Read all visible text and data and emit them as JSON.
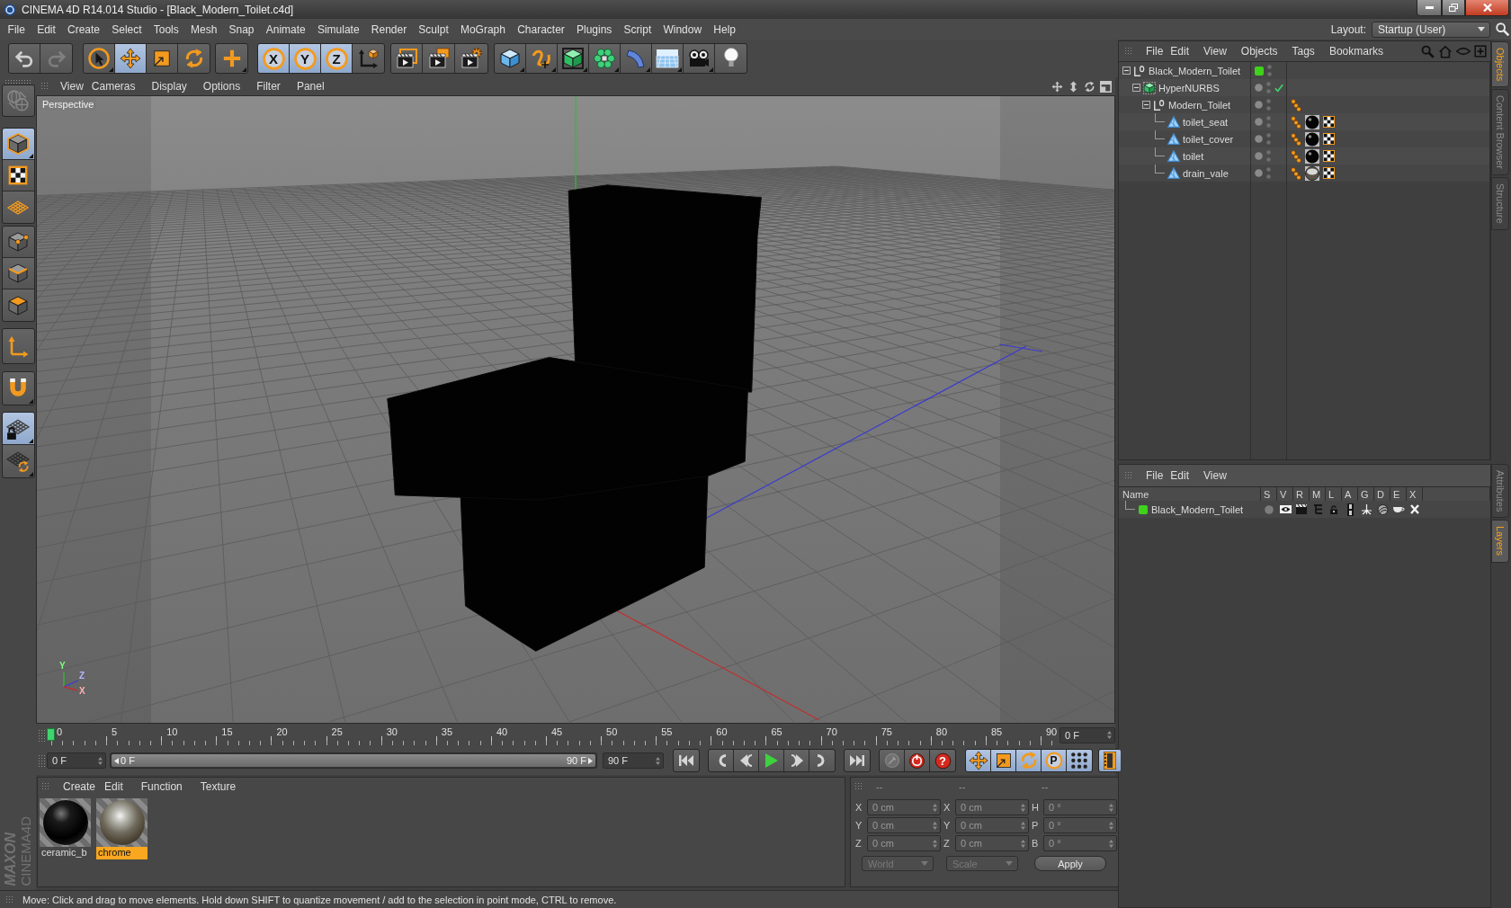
{
  "window": {
    "title": "CINEMA 4D R14.014 Studio - [Black_Modern_Toilet.c4d]"
  },
  "menu": [
    "File",
    "Edit",
    "Create",
    "Select",
    "Tools",
    "Mesh",
    "Snap",
    "Animate",
    "Simulate",
    "Render",
    "Sculpt",
    "MoGraph",
    "Character",
    "Plugins",
    "Script",
    "Window",
    "Help"
  ],
  "layout": {
    "label": "Layout:",
    "value": "Startup (User)"
  },
  "toolbar": {
    "history": [
      {
        "disabled": false
      },
      {
        "disabled": true
      }
    ],
    "tools": [
      {
        "selected": false
      },
      {
        "selected": true
      },
      {
        "selected": false
      },
      {
        "selected": false
      }
    ],
    "axis_locks": [
      {
        "label": "X",
        "on": true
      },
      {
        "label": "Y",
        "on": true
      },
      {
        "label": "Z",
        "on": true
      }
    ]
  },
  "left_toolbar": {
    "make_editable": {
      "disabled": true
    },
    "modes": [
      {
        "selected": true
      },
      {
        "selected": false
      },
      {
        "selected": false
      },
      {
        "selected": false
      },
      {
        "selected": false
      },
      {
        "selected": false
      }
    ],
    "workplane_lock": {
      "on": true
    }
  },
  "viewport": {
    "menu": [
      "View",
      "Cameras",
      "Display",
      "Options",
      "Filter",
      "Panel"
    ],
    "camera": "Perspective",
    "gizmo_axes": [
      "Y",
      "Z",
      "X"
    ]
  },
  "timeline": {
    "ticks": [
      "0",
      "5",
      "10",
      "15",
      "20",
      "25",
      "30",
      "35",
      "40",
      "45",
      "50",
      "55",
      "60",
      "65",
      "70",
      "75",
      "80",
      "85",
      "90"
    ],
    "playhead": {
      "level": 0
    },
    "current_frame": "0 F"
  },
  "transport": {
    "start_field": "0 F",
    "range": {
      "start": "0 F",
      "end": "90 F",
      "level": 1
    },
    "end_field": "90 F",
    "help": "?",
    "key_toggles": [
      {
        "on": true
      },
      {
        "on": true
      },
      {
        "on": true
      },
      {
        "label": "P",
        "on": true
      },
      {
        "on": true
      }
    ]
  },
  "materials": {
    "menu": [
      "Create",
      "Edit",
      "Function",
      "Texture"
    ],
    "items": [
      {
        "name": "ceramic_b",
        "kind": "ceramic",
        "selected": false
      },
      {
        "name": "chrome",
        "kind": "chrome",
        "selected": true
      }
    ]
  },
  "coordinates": {
    "headers": [
      "--",
      "--",
      "--"
    ],
    "rows": [
      [
        {
          "label": "X",
          "value": "0 cm"
        },
        {
          "label": "X",
          "value": "0 cm"
        },
        {
          "label": "H",
          "value": "0 °"
        }
      ],
      [
        {
          "label": "Y",
          "value": "0 cm"
        },
        {
          "label": "Y",
          "value": "0 cm"
        },
        {
          "label": "P",
          "value": "0 °"
        }
      ],
      [
        {
          "label": "Z",
          "value": "0 cm"
        },
        {
          "label": "Z",
          "value": "0 cm"
        },
        {
          "label": "B",
          "value": "0 °"
        }
      ]
    ],
    "dropdowns": [
      "World",
      "Scale"
    ],
    "apply": "Apply"
  },
  "status_bar": "Move: Click and drag to move elements. Hold down SHIFT to quantize movement / add to the selection in point mode, CTRL to remove.",
  "logo": {
    "brand": "MAXON",
    "product": "CINEMA4D"
  },
  "objects": {
    "menu": [
      "File",
      "Edit",
      "View",
      "Objects",
      "Tags",
      "Bookmarks"
    ],
    "tree": [
      {
        "name": "Black_Modern_Toilet",
        "kind": "null",
        "color": "#3fd11c",
        "expanded": true,
        "children": [
          {
            "name": "HyperNURBS",
            "kind": "hypernurbs",
            "expanded": true,
            "enabled": true,
            "children": [
              {
                "name": "Modern_Toilet",
                "kind": "null",
                "expanded": true,
                "tags": [
                  {
                    "kind": "phong"
                  }
                ],
                "children": [
                  {
                    "name": "toilet_seat",
                    "kind": "polygon",
                    "tags": [
                      {
                        "kind": "phong"
                      },
                      {
                        "kind": "ceramic"
                      },
                      {
                        "kind": "uvw"
                      }
                    ]
                  },
                  {
                    "name": "toilet_cover",
                    "kind": "polygon",
                    "tags": [
                      {
                        "kind": "phong"
                      },
                      {
                        "kind": "ceramic"
                      },
                      {
                        "kind": "uvw"
                      }
                    ]
                  },
                  {
                    "name": "toilet",
                    "kind": "polygon",
                    "tags": [
                      {
                        "kind": "phong"
                      },
                      {
                        "kind": "ceramic"
                      },
                      {
                        "kind": "uvw"
                      }
                    ]
                  },
                  {
                    "name": "drain_vale",
                    "kind": "polygon",
                    "tags": [
                      {
                        "kind": "phong"
                      },
                      {
                        "kind": "chrome"
                      },
                      {
                        "kind": "uvw"
                      }
                    ]
                  }
                ]
              }
            ]
          }
        ]
      }
    ]
  },
  "layers": {
    "menu": [
      "File",
      "Edit",
      "View"
    ],
    "columns": [
      "Name",
      "S",
      "V",
      "R",
      "M",
      "L",
      "A",
      "G",
      "D",
      "E",
      "X"
    ],
    "rows": [
      {
        "name": "Black_Modern_Toilet",
        "color": "#3fd11c"
      }
    ]
  },
  "side_tabs": {
    "top": [
      {
        "label": "Objects",
        "selected": true
      },
      {
        "label": "Content Browser",
        "selected": false
      },
      {
        "label": "Structure",
        "selected": false
      }
    ],
    "bottom": [
      {
        "label": "Attributes",
        "selected": false
      },
      {
        "label": "Layers",
        "selected": true
      }
    ]
  }
}
